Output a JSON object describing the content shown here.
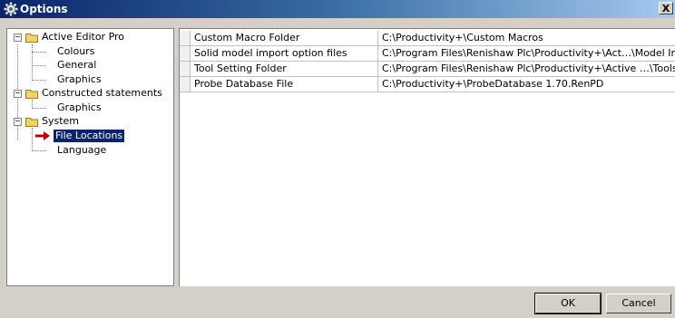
{
  "window": {
    "title": "Options",
    "close_label": "X"
  },
  "tree": {
    "items": [
      {
        "label": "Active Editor Pro",
        "type": "folder",
        "expander": "−"
      },
      {
        "label": "Colours",
        "type": "leaf"
      },
      {
        "label": "General",
        "type": "leaf"
      },
      {
        "label": "Graphics",
        "type": "leaf"
      },
      {
        "label": "Constructed statements",
        "type": "folder",
        "expander": "−"
      },
      {
        "label": "Graphics",
        "type": "leaf"
      },
      {
        "label": "System",
        "type": "folder",
        "expander": "−"
      },
      {
        "label": "File Locations",
        "type": "leaf",
        "selected": true
      },
      {
        "label": "Language",
        "type": "leaf"
      }
    ]
  },
  "grid": {
    "rows": [
      {
        "name": "Custom Macro Folder",
        "value": "C:\\Productivity+\\Custom Macros"
      },
      {
        "name": "Solid model import option files",
        "value": "C:\\Program Files\\Renishaw Plc\\Productivity+\\Act…\\Model Importer"
      },
      {
        "name": "Tool Setting Folder",
        "value": "C:\\Program Files\\Renishaw Plc\\Productivity+\\Active …\\Toolsetting"
      },
      {
        "name": "Probe Database File",
        "value": "C:\\Productivity+\\ProbeDatabase 1.70.RenPD"
      }
    ]
  },
  "buttons": {
    "ok": "OK",
    "cancel": "Cancel"
  },
  "colors": {
    "title_start": "#0a246a",
    "title_end": "#a6caf0",
    "folder": "#f3d26b",
    "arrow": "#c00000",
    "selection": "#0a246a"
  }
}
